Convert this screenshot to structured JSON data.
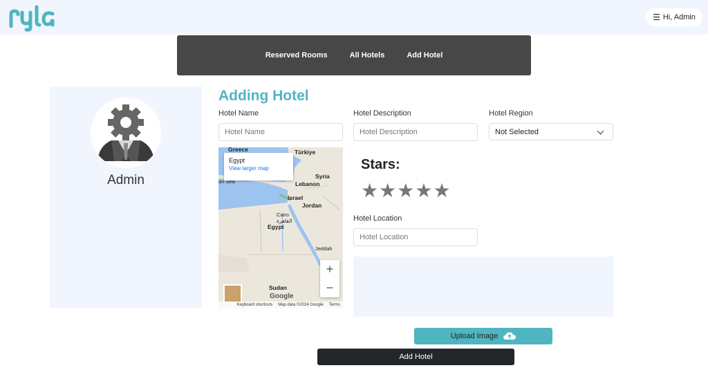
{
  "header": {
    "logo_text": "ryla",
    "user_menu_label": "Hi, Admin",
    "menu_icon": "hamburger-icon"
  },
  "nav": {
    "items": [
      {
        "label": "Reserved Rooms"
      },
      {
        "label": "All Hotels"
      },
      {
        "label": "Add Hotel"
      }
    ]
  },
  "profile": {
    "name": "Admin",
    "avatar_icon": "admin-gear-avatar-icon"
  },
  "form": {
    "title": "Adding Hotel",
    "hotel_name": {
      "label": "Hotel Name",
      "placeholder": "Hotel Name",
      "value": ""
    },
    "hotel_description": {
      "label": "Hotel Description",
      "placeholder": "Hotel Description",
      "value": ""
    },
    "hotel_region": {
      "label": "Hotel Region",
      "selected": "Not Selected"
    },
    "stars": {
      "label": "Stars:",
      "count": 5,
      "selected": 0
    },
    "hotel_location": {
      "label": "Hotel Location",
      "placeholder": "Hotel Location",
      "value": ""
    },
    "upload_label": "Upload Image",
    "submit_label": "Add Hotel"
  },
  "map": {
    "popup_title": "Egypt",
    "popup_link": "View larger map",
    "labels": {
      "greece": "Greece",
      "turkiye": "Türkiye",
      "syria": "Syria",
      "lebanon": "Lebanon",
      "israel": "Israel",
      "jordan": "Jordan",
      "cairo": "Cairo",
      "cairo_ar": "القاهرة",
      "egypt": "Egypt",
      "jeddah": "Jeddah",
      "sudan": "Sudan",
      "sea": "an Sea"
    },
    "zoom_in": "+",
    "zoom_out": "−",
    "brand": "Google",
    "footer": [
      "Keyboard shortcuts",
      "Map data ©2024 Google",
      "Terms"
    ]
  },
  "colors": {
    "accent": "#4fb5bf",
    "nav_bg": "#474747",
    "panel_bg": "#f1f5fd",
    "dark_button": "#23262b",
    "star": "#777777"
  }
}
